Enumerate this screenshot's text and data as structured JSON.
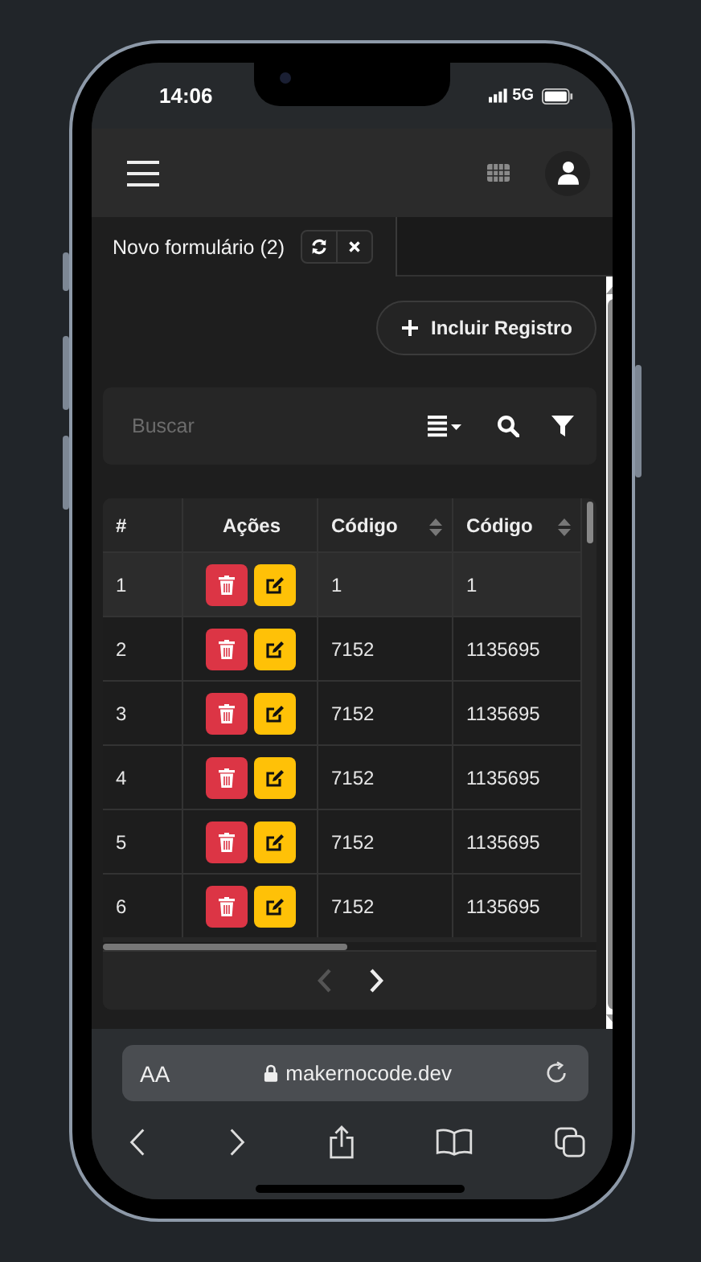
{
  "status_bar": {
    "time": "14:06",
    "network": "5G"
  },
  "tab": {
    "label": "Novo formulário (2)",
    "selected": true
  },
  "add_button": "Incluir Registro",
  "search": {
    "placeholder": "Buscar"
  },
  "table": {
    "columns": [
      {
        "label": "#",
        "sortable": false
      },
      {
        "label": "Ações",
        "sortable": false
      },
      {
        "label": "Código",
        "sortable": true
      },
      {
        "label": "Código",
        "sortable": true
      }
    ],
    "rows": [
      {
        "cells": [
          "1",
          "",
          "1",
          "1"
        ],
        "selected": true
      },
      {
        "cells": [
          "2",
          "",
          "7152",
          "1135695"
        ],
        "selected": false
      },
      {
        "cells": [
          "3",
          "",
          "7152",
          "1135695"
        ],
        "selected": false
      },
      {
        "cells": [
          "4",
          "",
          "7152",
          "1135695"
        ],
        "selected": false
      },
      {
        "cells": [
          "5",
          "",
          "7152",
          "1135695"
        ],
        "selected": false
      },
      {
        "cells": [
          "6",
          "",
          "7152",
          "1135695"
        ],
        "selected": false
      }
    ]
  },
  "pagination": {
    "prev_disabled": true,
    "next_disabled": false
  },
  "browser": {
    "text_size": "AA",
    "url": "makernocode.dev"
  }
}
